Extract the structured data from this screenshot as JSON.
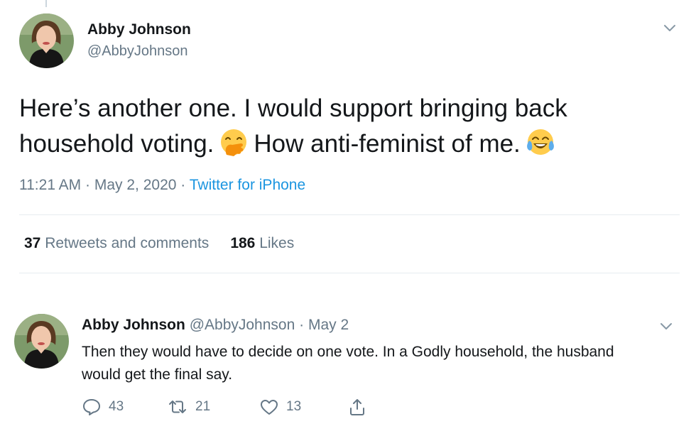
{
  "tweet": {
    "author_name": "Abby Johnson",
    "author_handle": "@AbbyJohnson",
    "text_line1": "Here’s another one. I would support bringing back",
    "text_line2a": "household voting.",
    "text_line2b": "How anti-feminist of me.",
    "emoji1": "hand-over-mouth-emoji",
    "emoji2": "tears-of-joy-emoji",
    "time": "11:21 AM",
    "date": "May 2, 2020",
    "separator": "·",
    "source": "Twitter for iPhone",
    "retweets_count": "37",
    "retweets_label": "Retweets and comments",
    "likes_count": "186",
    "likes_label": "Likes"
  },
  "reply": {
    "author_name": "Abby Johnson",
    "author_handle": "@AbbyJohnson",
    "separator": "·",
    "date": "May 2",
    "text": "Then they would have to decide on one vote. In a Godly household, the husband would get the final say.",
    "replies": "43",
    "retweets": "21",
    "likes": "13"
  },
  "icons": {
    "menu": "chevron-down-icon",
    "reply": "comment-icon",
    "retweet": "retweet-icon",
    "like": "heart-icon",
    "share": "share-icon"
  },
  "colors": {
    "link": "#1b95e0",
    "secondary_text": "#657786",
    "primary_text": "#14171a",
    "divider": "#e6ecf0"
  }
}
